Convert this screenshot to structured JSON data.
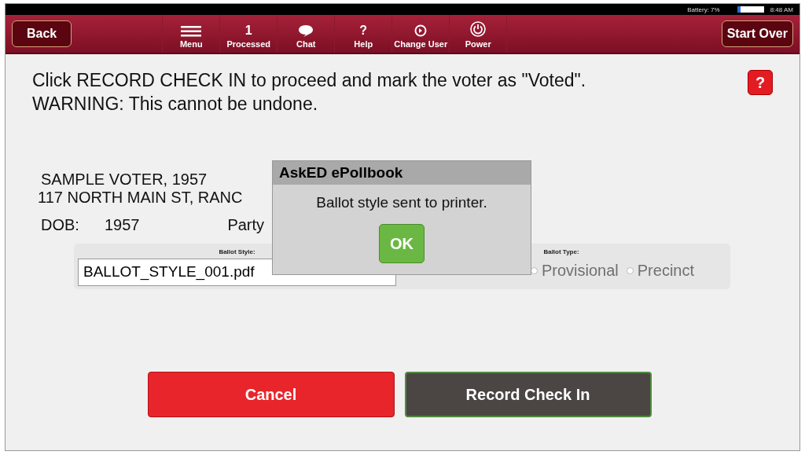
{
  "status_bar": {
    "battery_label": "Battery: 7%",
    "time": "8:48 AM"
  },
  "toolbar": {
    "back": "Back",
    "start_over": "Start Over",
    "items": [
      {
        "kind": "menu",
        "label": "Menu"
      },
      {
        "kind": "count",
        "count": "1",
        "label": "Processed"
      },
      {
        "kind": "chat",
        "label": "Chat"
      },
      {
        "kind": "help",
        "glyph": "?",
        "label": "Help"
      },
      {
        "kind": "user",
        "label": "Change User"
      },
      {
        "kind": "power",
        "label": "Power"
      }
    ]
  },
  "instructions": [
    "Click RECORD CHECK IN to proceed and mark the voter as \"Voted\".",
    "WARNING: This cannot be undone."
  ],
  "help_button": "?",
  "voter": {
    "name": "SAMPLE VOTER, 1957",
    "address": "117 NORTH MAIN ST, RANC",
    "dob_label": "DOB:",
    "dob": "1957",
    "party_label": "Party"
  },
  "ballot_style": {
    "label": "Ballot Style:",
    "value": "BALLOT_STYLE_001.pdf"
  },
  "ballot_type": {
    "label": "Ballot Type:",
    "options": [
      {
        "label": "Provisional",
        "selected": false
      },
      {
        "label": "Precinct",
        "selected": false
      }
    ]
  },
  "dialog": {
    "title": "AskED ePollbook",
    "message": "Ballot style sent to printer.",
    "ok": "OK"
  },
  "buttons": [
    {
      "kind": "cancel",
      "label": "Cancel"
    },
    {
      "kind": "record",
      "label": "Record Check In"
    }
  ]
}
